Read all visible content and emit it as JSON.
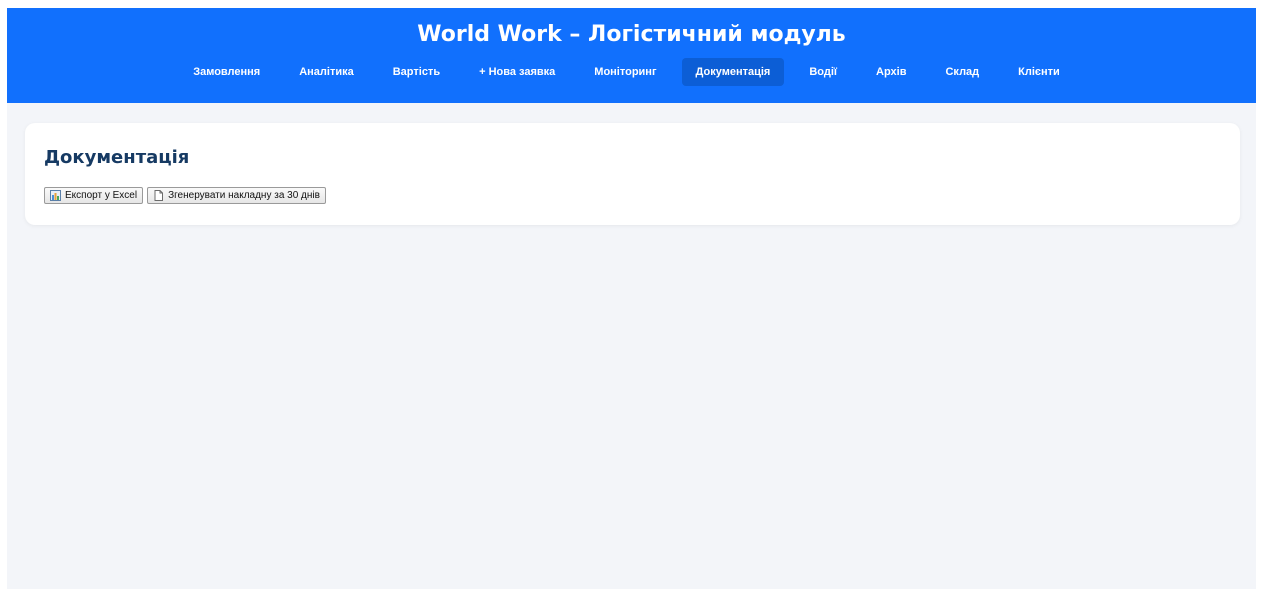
{
  "header": {
    "title": "World Work – Логістичний модуль",
    "nav": [
      {
        "label": "Замовлення",
        "name": "nav-orders"
      },
      {
        "label": "Аналітика",
        "name": "nav-analytics"
      },
      {
        "label": "Вартість",
        "name": "nav-cost"
      },
      {
        "label": "+ Нова заявка",
        "name": "nav-new-request"
      },
      {
        "label": "Моніторинг",
        "name": "nav-monitoring"
      },
      {
        "label": "Документація",
        "name": "nav-documentation",
        "active": true
      },
      {
        "label": "Водії",
        "name": "nav-drivers"
      },
      {
        "label": "Архів",
        "name": "nav-archive"
      },
      {
        "label": "Склад",
        "name": "nav-warehouse"
      },
      {
        "label": "Клієнти",
        "name": "nav-clients"
      }
    ]
  },
  "main": {
    "title": "Документація",
    "buttons": {
      "export_label": "Експорт у Excel",
      "export_icon": "chart-icon",
      "generate_label": "Згенерувати накладну за 30 днів",
      "generate_icon": "document-icon"
    }
  },
  "colors": {
    "header_bg": "#1170fd",
    "active_tab_bg": "#0c5ed6",
    "page_bg": "#f3f5f9",
    "title_color": "#163a63"
  }
}
